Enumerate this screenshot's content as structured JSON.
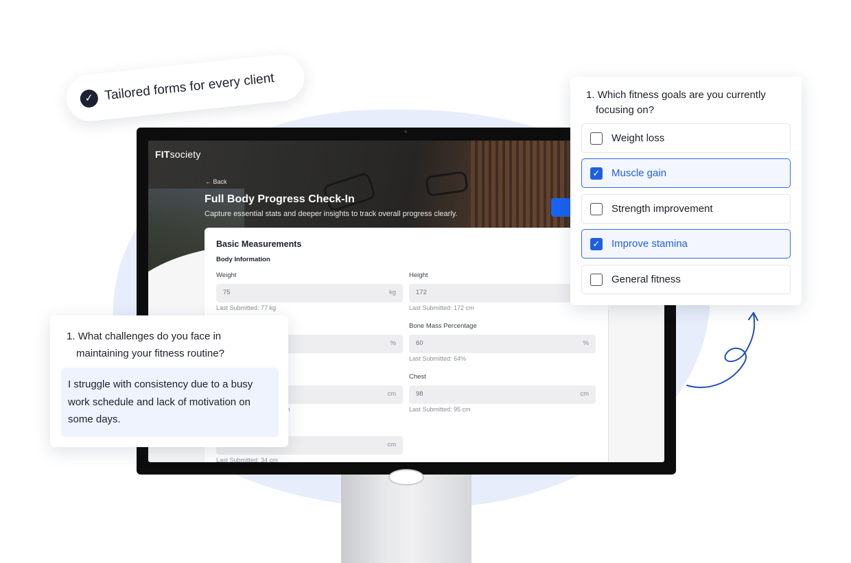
{
  "badge": {
    "text": "Tailored forms for every client",
    "icon": "check-icon"
  },
  "app": {
    "logo_bold": "FIT",
    "logo_rest": "society",
    "back_label": "← Back",
    "form_title": "Full Body Progress Check-In",
    "form_subtitle": "Capture essential stats and deeper insights to track overall progress clearly.",
    "section_title": "Basic Measurements",
    "group_title": "Body Information",
    "fields": [
      {
        "label": "Weight",
        "value": "75",
        "unit": "kg",
        "hint": "Last Submitted: 77 kg"
      },
      {
        "label": "Height",
        "value": "172",
        "unit": "",
        "hint": "Last Submitted: 172 cm"
      },
      {
        "label": "",
        "value": "",
        "unit": "%",
        "hint": ""
      },
      {
        "label": "Bone Mass Percentage",
        "value": "60",
        "unit": "%",
        "hint": "Last Submitted: 64%"
      },
      {
        "label": "",
        "value": "",
        "unit": "cm",
        "hint": "m"
      },
      {
        "label": "Chest",
        "value": "98",
        "unit": "cm",
        "hint": "Last Submitted: 95 cm"
      },
      {
        "label": "",
        "value": "",
        "unit": "cm",
        "hint": "Last Submitted: 34 cm"
      }
    ]
  },
  "goals": {
    "question_num": "1.",
    "question_line1": "Which fitness goals are you currently",
    "question_line2": "focusing on?",
    "options": [
      {
        "label": "Weight loss",
        "checked": false
      },
      {
        "label": "Muscle gain",
        "checked": true
      },
      {
        "label": "Strength improvement",
        "checked": false
      },
      {
        "label": "Improve stamina",
        "checked": true
      },
      {
        "label": "General fitness",
        "checked": false
      }
    ],
    "accent": "#1f5fe0"
  },
  "challenges": {
    "question_num": "1.",
    "question_line1": "What challenges do you face in",
    "question_line2": "maintaining your fitness routine?",
    "answer": "I struggle with consistency due to a busy work schedule and lack of motivation on some days."
  }
}
